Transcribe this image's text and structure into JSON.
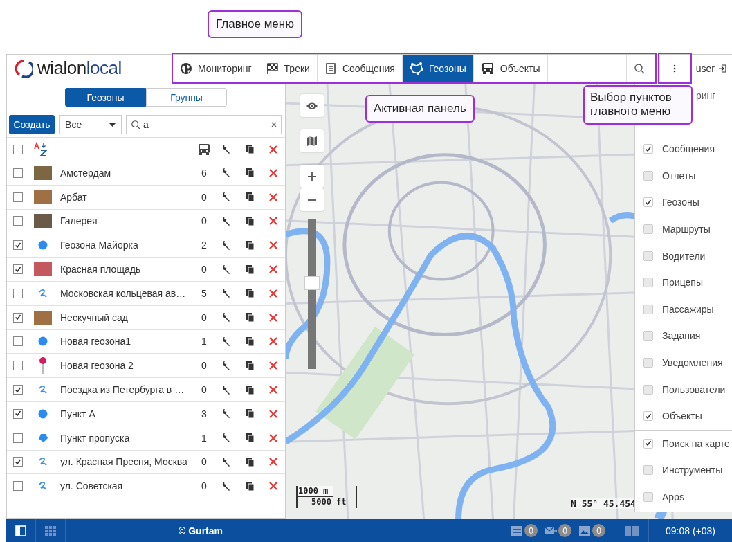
{
  "topbar": {
    "logo": {
      "brand": "wialon",
      "edition": "local"
    },
    "menu": [
      {
        "label": "Мониторинг",
        "kind": "globe",
        "selected": false
      },
      {
        "label": "Треки",
        "kind": "flag",
        "selected": false
      },
      {
        "label": "Сообщения",
        "kind": "document",
        "selected": false
      },
      {
        "label": "Геозоны",
        "kind": "geofence",
        "selected": true
      },
      {
        "label": "Объекты",
        "kind": "bus",
        "selected": false
      }
    ],
    "user": "user"
  },
  "left_panel": {
    "tabs": [
      {
        "label": "Геозоны",
        "selected": true
      },
      {
        "label": "Группы",
        "selected": false
      }
    ],
    "create_button": "Создать",
    "filter": {
      "value": "Все"
    },
    "search": {
      "value": "а"
    },
    "select_all_checked": false,
    "rows": [
      {
        "checked": false,
        "kind": "photo",
        "name": "Амстердам",
        "count": "6"
      },
      {
        "checked": false,
        "kind": "photo",
        "name": "Арбат",
        "count": "0"
      },
      {
        "checked": false,
        "kind": "photo",
        "name": "Галерея",
        "count": "0"
      },
      {
        "checked": true,
        "kind": "circle",
        "name": "Геозона Майорка",
        "count": "2"
      },
      {
        "checked": true,
        "kind": "photo",
        "name": "Красная площадь",
        "count": "0"
      },
      {
        "checked": false,
        "kind": "line",
        "name": "Московская кольцевая ав…",
        "count": "5"
      },
      {
        "checked": true,
        "kind": "photo",
        "name": "Нескучный сад",
        "count": "0"
      },
      {
        "checked": false,
        "kind": "circle",
        "name": "Новая геозона1",
        "count": "1"
      },
      {
        "checked": false,
        "kind": "pin",
        "name": "Новая геозона 2",
        "count": "0"
      },
      {
        "checked": true,
        "kind": "line",
        "name": "Поездка из Петербурга в …",
        "count": "0"
      },
      {
        "checked": true,
        "kind": "circle",
        "name": "Пункт А",
        "count": "3"
      },
      {
        "checked": false,
        "kind": "polygon",
        "name": "Пункт пропуска",
        "count": "1"
      },
      {
        "checked": true,
        "kind": "line",
        "name": "ул. Красная Пресня, Москва",
        "count": "0"
      },
      {
        "checked": false,
        "kind": "line",
        "name": "ул. Советская",
        "count": "0"
      }
    ]
  },
  "map": {
    "zoom_slider": {
      "level": 0.58
    },
    "scale": {
      "metric": "1000 m",
      "imperial": "5000 ft"
    },
    "coordinates": "N 55° 45.454"
  },
  "menu_settings": {
    "cut_item": "ринг",
    "items": [
      {
        "label": "Сообщения",
        "checked": true
      },
      {
        "label": "Отчеты",
        "checked": false
      },
      {
        "label": "Геозоны",
        "checked": true
      },
      {
        "label": "Маршруты",
        "checked": false
      },
      {
        "label": "Водители",
        "checked": false
      },
      {
        "label": "Прицепы",
        "checked": false
      },
      {
        "label": "Пассажиры",
        "checked": false
      },
      {
        "label": "Задания",
        "checked": false
      },
      {
        "label": "Уведомления",
        "checked": false
      },
      {
        "label": "Пользователи",
        "checked": false
      },
      {
        "label": "Объекты",
        "checked": true
      }
    ],
    "extra_items": [
      {
        "label": "Поиск на карте",
        "checked": true
      },
      {
        "label": "Инструменты",
        "checked": false
      },
      {
        "label": "Apps",
        "checked": false
      }
    ]
  },
  "status_bar": {
    "copyright": "© Gurtam",
    "counters": [
      {
        "kind": "messages",
        "count": "0"
      },
      {
        "kind": "mail",
        "count": "0"
      },
      {
        "kind": "image",
        "count": "0"
      }
    ],
    "time": "09:08 (+03)"
  },
  "annotations": [
    {
      "kind": "main-menu",
      "text": "Главное меню"
    },
    {
      "kind": "active-panel",
      "text": "Активная панель"
    },
    {
      "kind": "menu-choice",
      "text": "Выбор пунктов главного меню"
    }
  ]
}
